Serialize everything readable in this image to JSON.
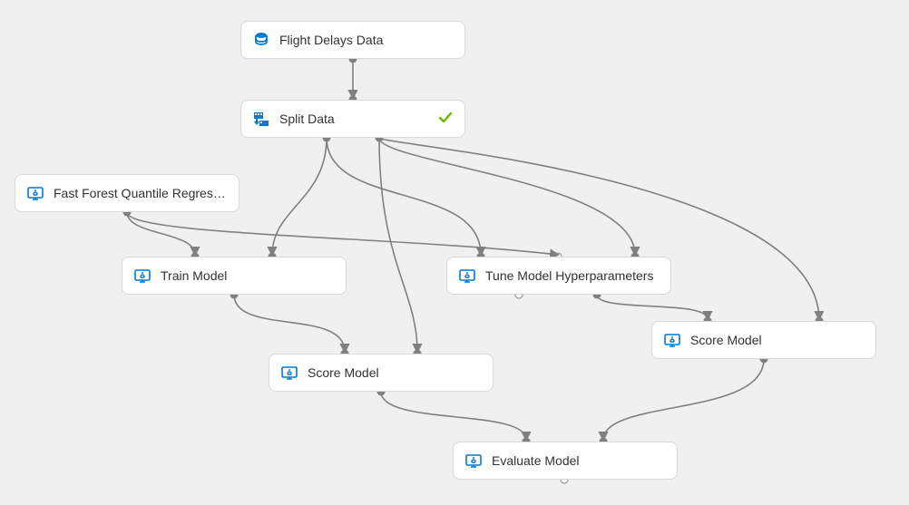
{
  "nodes": {
    "flight_data": {
      "label": "Flight Delays Data",
      "icon": "dataset",
      "status": null
    },
    "split_data": {
      "label": "Split Data",
      "icon": "transform",
      "status": "success"
    },
    "ffqr": {
      "label": "Fast Forest Quantile Regress...",
      "icon": "ml",
      "status": null
    },
    "train_model": {
      "label": "Train Model",
      "icon": "ml",
      "status": null
    },
    "tune_hparams": {
      "label": "Tune Model Hyperparameters",
      "icon": "ml",
      "status": null
    },
    "score_left": {
      "label": "Score Model",
      "icon": "ml",
      "status": null
    },
    "score_right": {
      "label": "Score Model",
      "icon": "ml",
      "status": null
    },
    "evaluate": {
      "label": "Evaluate Model",
      "icon": "ml",
      "status": null
    }
  },
  "colors": {
    "icon_blue": "#0078d4",
    "check_green": "#6bb700",
    "edge_gray": "#808080"
  }
}
